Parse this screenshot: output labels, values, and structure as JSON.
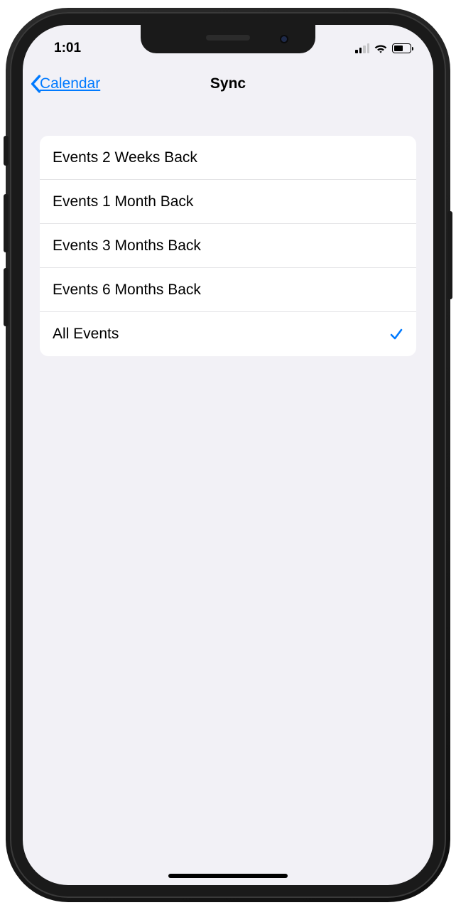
{
  "status": {
    "time": "1:01"
  },
  "nav": {
    "back_label": "Calendar",
    "title": "Sync"
  },
  "options": [
    {
      "label": "Events 2 Weeks Back",
      "selected": false
    },
    {
      "label": "Events 1 Month Back",
      "selected": false
    },
    {
      "label": "Events 3 Months Back",
      "selected": false
    },
    {
      "label": "Events 6 Months Back",
      "selected": false
    },
    {
      "label": "All Events",
      "selected": true
    }
  ]
}
